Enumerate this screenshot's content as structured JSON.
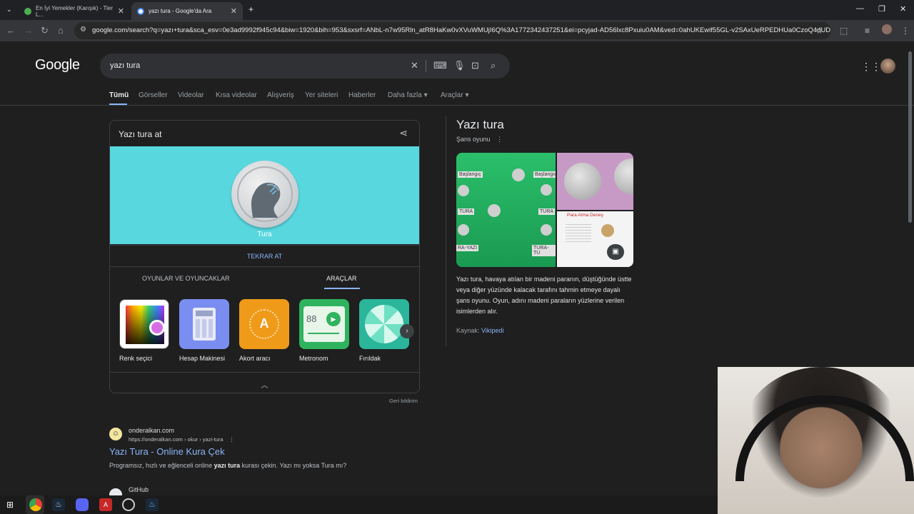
{
  "browser": {
    "tabs": [
      {
        "title": "En İyi Yemekler (Karışık) - Tier L...",
        "active": false
      },
      {
        "title": "yazı tura - Google'da Ara",
        "active": true
      }
    ],
    "new_tab_symbol": "+",
    "url": "google.com/search?q=yazı+tura&sca_esv=0e3ad9992f945c94&biw=1920&bih=953&sxsrf=ANbL-n7w95Rln_atR8HaKw0vXVuWMUjI6Q%3A1772342437251&ei=pcyjad-AD56lxc8Pxuiu0AM&ved=0ahUKEwif55GL-v2SAxUeRPEDHUa0CzoQ4dUD..."
  },
  "google": {
    "logo": "Google",
    "query": "yazı tura",
    "nav_tabs": [
      "Tümü",
      "Görseller",
      "Videolar",
      "Kısa videolar",
      "Alışveriş",
      "Yer siteleri",
      "Haberler",
      "Daha fazla",
      "Araçlar"
    ],
    "dropdown_caret": "▾"
  },
  "coin_card": {
    "title": "Yazı tura at",
    "coin_label": "Tura",
    "flip_button": "TEKRAR AT",
    "sub_tabs": [
      "OYUNLAR VE OYUNCAKLAR",
      "ARAÇLAR"
    ],
    "tools": [
      {
        "label": "Renk seçici",
        "icon": "color-picker-icon"
      },
      {
        "label": "Hesap Makinesi",
        "icon": "calculator-icon"
      },
      {
        "label": "Akort aracı",
        "icon": "tuner-icon",
        "glyph": "A"
      },
      {
        "label": "Metronom",
        "icon": "metronome-icon",
        "value": "88"
      },
      {
        "label": "Fırıldak",
        "icon": "spinner-icon"
      }
    ],
    "feedback": "Geri bildirim"
  },
  "result": {
    "site_name": "onderalkan.com",
    "url": "https://onderalkan.com › okur › yazi-tura",
    "title": "Yazı Tura - Online Kura Çek",
    "snippet_parts": [
      "Programsız, hızlı ve eğlenceli online ",
      "yazı tura",
      " kurası çekin. Yazı mı yoksa Tura mı?"
    ],
    "next_site": "GitHub"
  },
  "knowledge_panel": {
    "title": "Yazı tura",
    "subtitle": "Şans oyunu",
    "description": "Yazı tura, havaya atılan bir madeni paranın, düştüğünde üstte veya diğer yüzünde kalacak tarafını tahmin etmeye dayalı şans oyunu. Oyun, adını madeni paraların yüzlerine verilen isimlerden alır.",
    "source_label": "Kaynak:",
    "source_link": "Vikipedi",
    "image_labels": [
      "Başlangıç",
      "Başlangıç",
      "TURA",
      "TURA",
      "RA-YAZI",
      "TURA-TU",
      "Para Atma Deney"
    ]
  },
  "colors": {
    "background": "#1f1f1f",
    "link": "#8ab4f8",
    "coin_stage": "#58d7df"
  }
}
